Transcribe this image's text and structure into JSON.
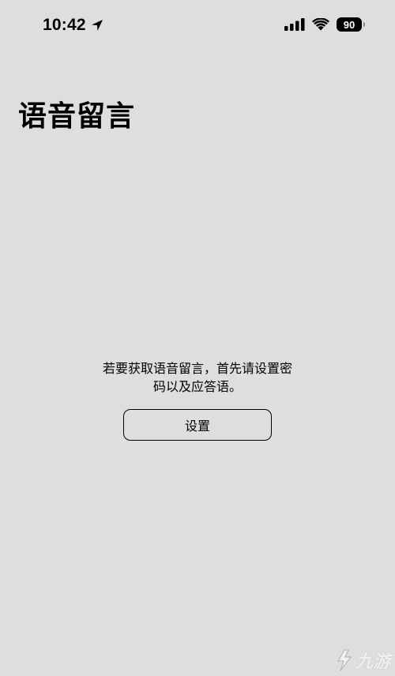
{
  "status_bar": {
    "time": "10:42",
    "battery_level": "90",
    "icons": [
      "location-arrow-icon",
      "cellular-signal-icon",
      "wifi-icon",
      "battery-icon"
    ]
  },
  "page": {
    "title": "语音留言",
    "message": "若要获取语音留言，首先请设置密码以及应答语。",
    "setup_button_label": "设置"
  },
  "watermark": {
    "text": "九游"
  },
  "colors": {
    "background": "#dedede",
    "text": "#000000"
  }
}
